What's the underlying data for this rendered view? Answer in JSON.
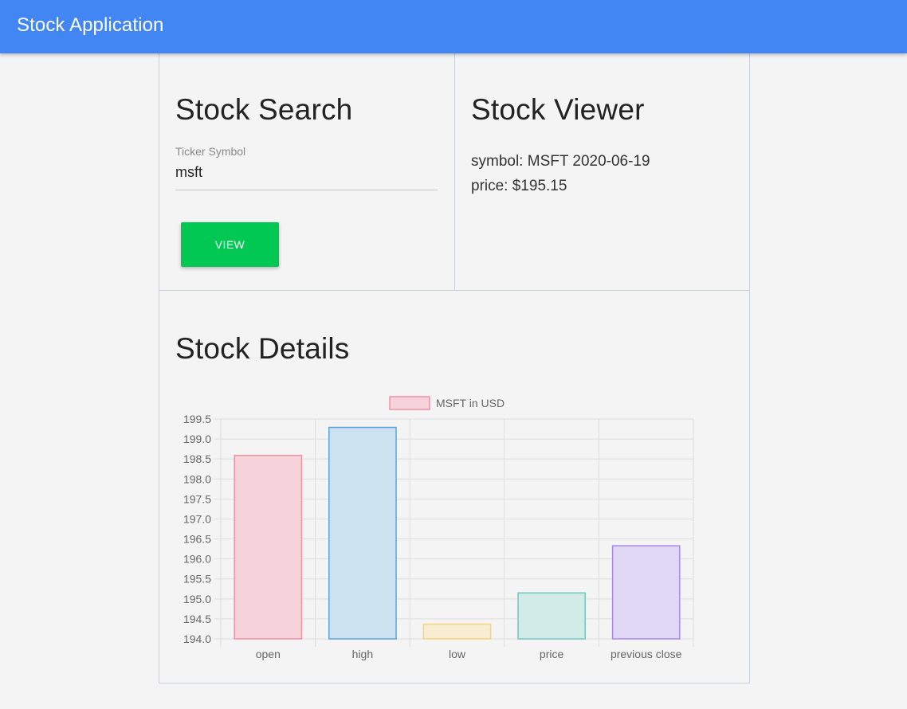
{
  "app": {
    "title": "Stock Application",
    "bar_color": "#4286f4"
  },
  "search": {
    "title": "Stock Search",
    "field_label": "Ticker Symbol",
    "field_value": "msft",
    "button_label": "VIEW",
    "button_color": "#00c853"
  },
  "viewer": {
    "title": "Stock Viewer",
    "symbol_line": "symbol: MSFT 2020-06-19",
    "price_line": "price: $195.15"
  },
  "details": {
    "title": "Stock Details"
  },
  "chart_data": {
    "type": "bar",
    "categories": [
      "open",
      "high",
      "low",
      "price",
      "previous close"
    ],
    "series": [
      {
        "name": "MSFT in USD",
        "values": [
          198.59,
          199.29,
          194.37,
          195.15,
          196.33
        ]
      }
    ],
    "bar_fill_colors": [
      "#f6d3db",
      "#cde2f0",
      "#f8ecd3",
      "#d2eae8",
      "#e0d7f5"
    ],
    "bar_stroke_colors": [
      "#f58fa6",
      "#5aa4d8",
      "#f6d57a",
      "#71c8c0",
      "#a88ae6"
    ],
    "legend_color": {
      "fill": "#f6d3db",
      "stroke": "#f58fa6"
    },
    "ylim": [
      194.0,
      199.5
    ],
    "y_ticks": [
      "199.5",
      "199.0",
      "198.5",
      "198.0",
      "197.5",
      "197.0",
      "196.5",
      "196.0",
      "195.5",
      "195.0",
      "194.5",
      "194.0"
    ],
    "grid": true,
    "legend_position": "top"
  }
}
